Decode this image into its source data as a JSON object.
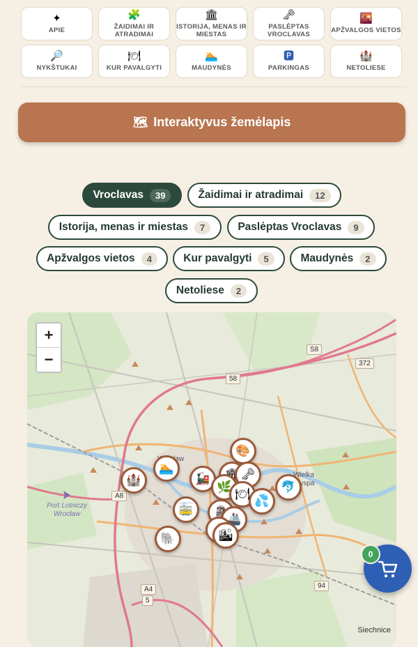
{
  "nav": [
    {
      "label": "Apie",
      "icon": "✦"
    },
    {
      "label": "Žaidimai ir atradimai",
      "icon": "🧩"
    },
    {
      "label": "Istorija, menas ir miestas",
      "icon": "🏛"
    },
    {
      "label": "Paslėptas Vroclavas",
      "icon": "🗝"
    },
    {
      "label": "Apžvalgos vietos",
      "icon": "🌇"
    },
    {
      "label": "Nykštukai",
      "icon": "🔎"
    },
    {
      "label": "Kur pavalgyti",
      "icon": "🍽"
    },
    {
      "label": "Maudynės",
      "icon": "🏊"
    },
    {
      "label": "Parkingas",
      "icon": "🅿"
    },
    {
      "label": "Netoliese",
      "icon": "🏰"
    }
  ],
  "map_cta": {
    "icon": "🗺",
    "label": "Interaktyvus žemėlapis"
  },
  "filters": [
    {
      "label": "Vroclavas",
      "count": "39",
      "active": true
    },
    {
      "label": "Žaidimai ir atradimai",
      "count": "12"
    },
    {
      "label": "Istorija, menas ir miestas",
      "count": "7"
    },
    {
      "label": "Paslėptas Vroclavas",
      "count": "9"
    },
    {
      "label": "Apžvalgos vietos",
      "count": "4"
    },
    {
      "label": "Kur pavalgyti",
      "count": "5"
    },
    {
      "label": "Maudynės",
      "count": "2"
    },
    {
      "label": "Netoliese",
      "count": "2"
    }
  ],
  "map": {
    "zoom_in": "+",
    "zoom_out": "−",
    "labels": {
      "wroclaw": "Wrocław",
      "airport": "Port Lotniczy Wrocław",
      "wielka": "Wielka Wyspa",
      "siechnice": "Siechnice"
    },
    "roads": {
      "s8": "S8",
      "r372": "372",
      "r58": "58",
      "a8": "A8",
      "a4": "A4",
      "r5": "5",
      "r94": "94"
    }
  },
  "cart": {
    "count": "0"
  },
  "colors": {
    "accent": "#b87550",
    "green": "#2c4a3c",
    "cart": "#2d5fb4",
    "badge": "#41a45a"
  }
}
